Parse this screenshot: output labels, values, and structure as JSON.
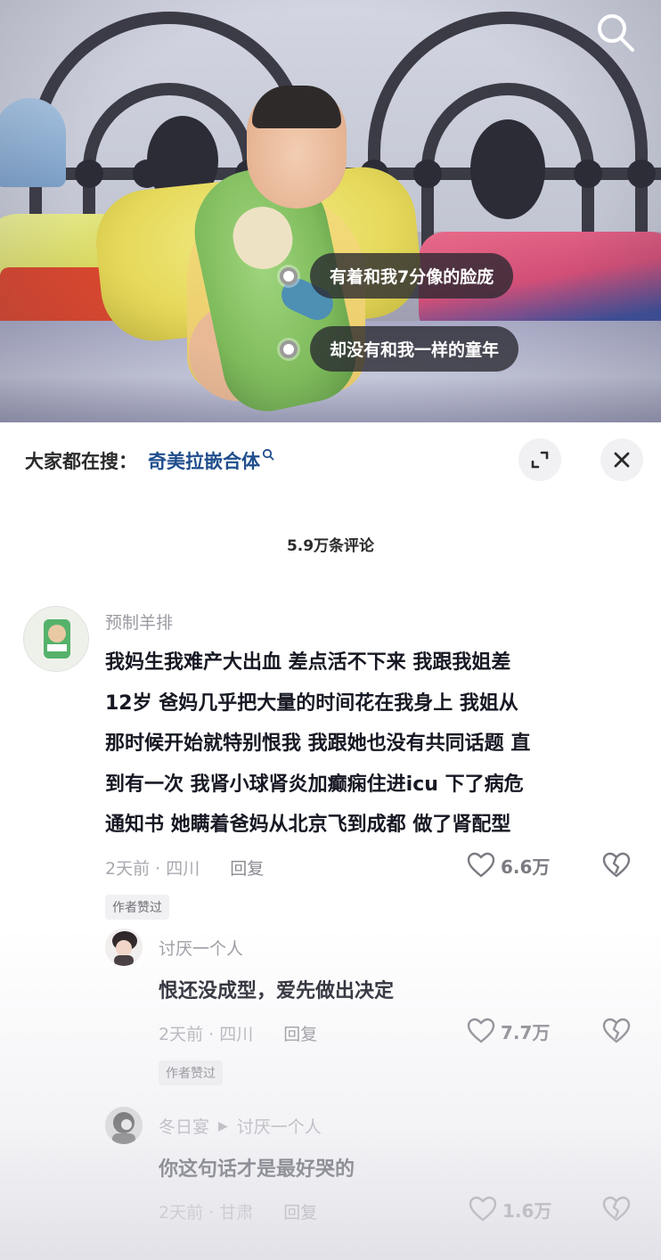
{
  "video": {
    "caption1": "有着和我7分像的脸庞",
    "caption2": "却没有和我一样的童年",
    "search_icon": "search-icon"
  },
  "trending": {
    "label": "大家都在搜：",
    "keyword": "奇美拉嵌合体",
    "expand_icon": "expand-icon",
    "close_icon": "close-icon"
  },
  "comment_count": "5.9万条评论",
  "comments": [
    {
      "user": "预制羊排",
      "lines": [
        "我妈生我难产大出血 差点活不下来 我跟我姐差",
        "12岁 爸妈几乎把大量的时间花在我身上 我姐从",
        "那时候开始就特别恨我 我跟她也没有共同话题 直",
        "到有一次 我肾小球肾炎加癫痫住进icu 下了病危",
        "通知书 她瞒着爸妈从北京飞到成都 做了肾配型"
      ],
      "time": "2天前 · 四川",
      "reply": "回复",
      "likes": "6.6万",
      "badge": "作者赞过"
    },
    {
      "user": "讨厌一个人",
      "text": "恨还没成型，爱先做出决定",
      "time": "2天前 · 四川",
      "reply": "回复",
      "likes": "7.7万",
      "badge": "作者赞过"
    },
    {
      "user": "冬日宴",
      "arrow": "▶",
      "reply_to": "讨厌一个人",
      "text": "你这句话才是最好哭的",
      "time": "2天前 · 甘肃",
      "reply": "回复",
      "likes": "1.6万"
    }
  ],
  "colors": {
    "keyword": "#1f4e8d",
    "text": "#161823",
    "muted": "#a8a8b0"
  }
}
